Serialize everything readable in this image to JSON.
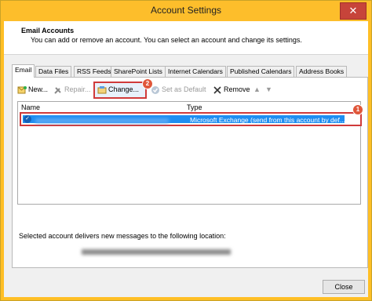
{
  "window": {
    "title": "Account Settings",
    "close_glyph": "✕"
  },
  "header": {
    "title": "Email Accounts",
    "description": "You can add or remove an account. You can select an account and change its settings."
  },
  "tabs": [
    {
      "label": "Email",
      "active": true
    },
    {
      "label": "Data Files",
      "active": false
    },
    {
      "label": "RSS Feeds",
      "active": false
    },
    {
      "label": "SharePoint Lists",
      "active": false
    },
    {
      "label": "Internet Calendars",
      "active": false
    },
    {
      "label": "Published Calendars",
      "active": false
    },
    {
      "label": "Address Books",
      "active": false
    }
  ],
  "toolbar": {
    "new_label": "New...",
    "repair_label": "Repair...",
    "change_label": "Change...",
    "set_default_label": "Set as Default",
    "remove_label": "Remove",
    "up_glyph": "▲",
    "down_glyph": "▼"
  },
  "annotations": {
    "badge_1": "1",
    "badge_2": "2",
    "highlight_color": "#d03a3a"
  },
  "accounts_list": {
    "columns": [
      "Name",
      "Type"
    ],
    "rows": [
      {
        "type": "Microsoft Exchange (send from this account by def...",
        "selected": true
      }
    ]
  },
  "delivery": {
    "label": "Selected account delivers new messages to the following location:"
  },
  "footer": {
    "close_label": "Close"
  }
}
